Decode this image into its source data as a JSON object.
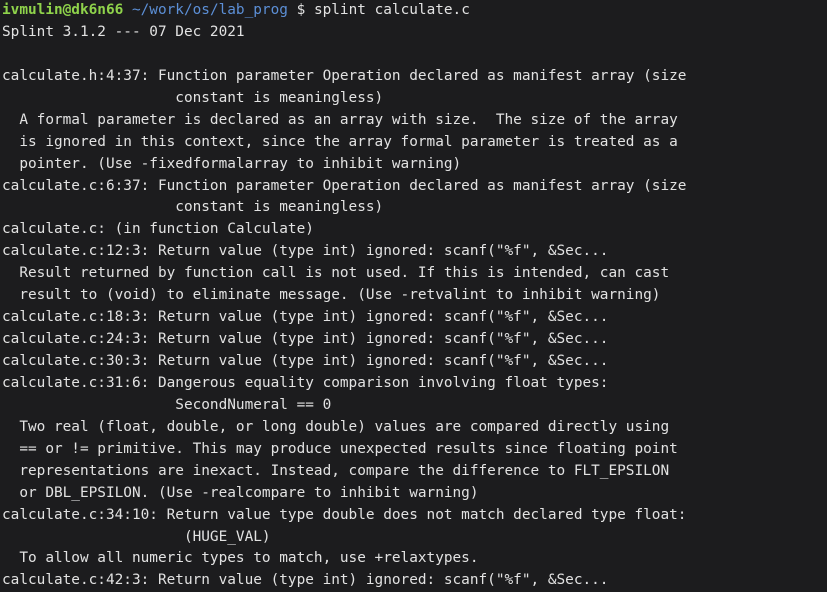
{
  "prompt": {
    "user_host": "ivmulin@dk6n66",
    "path": "~/work/os/lab_prog",
    "symbol": "$",
    "command": "splint calculate.c"
  },
  "output_lines": [
    "Splint 3.1.2 --- 07 Dec 2021",
    "",
    "calculate.h:4:37: Function parameter Operation declared as manifest array (size",
    "                    constant is meaningless)",
    "  A formal parameter is declared as an array with size.  The size of the array",
    "  is ignored in this context, since the array formal parameter is treated as a",
    "  pointer. (Use -fixedformalarray to inhibit warning)",
    "calculate.c:6:37: Function parameter Operation declared as manifest array (size",
    "                    constant is meaningless)",
    "calculate.c: (in function Calculate)",
    "calculate.c:12:3: Return value (type int) ignored: scanf(\"%f\", &Sec...",
    "  Result returned by function call is not used. If this is intended, can cast",
    "  result to (void) to eliminate message. (Use -retvalint to inhibit warning)",
    "calculate.c:18:3: Return value (type int) ignored: scanf(\"%f\", &Sec...",
    "calculate.c:24:3: Return value (type int) ignored: scanf(\"%f\", &Sec...",
    "calculate.c:30:3: Return value (type int) ignored: scanf(\"%f\", &Sec...",
    "calculate.c:31:6: Dangerous equality comparison involving float types:",
    "                    SecondNumeral == 0",
    "  Two real (float, double, or long double) values are compared directly using",
    "  == or != primitive. This may produce unexpected results since floating point",
    "  representations are inexact. Instead, compare the difference to FLT_EPSILON",
    "  or DBL_EPSILON. (Use -realcompare to inhibit warning)",
    "calculate.c:34:10: Return value type double does not match declared type float:",
    "                     (HUGE_VAL)",
    "  To allow all numeric types to match, use +relaxtypes.",
    "calculate.c:42:3: Return value (type int) ignored: scanf(\"%f\", &Sec..."
  ],
  "colors": {
    "background": "#1c1c1e",
    "text": "#e2e2e2",
    "user_host": "#8fd34b",
    "path": "#5c8fd6"
  }
}
